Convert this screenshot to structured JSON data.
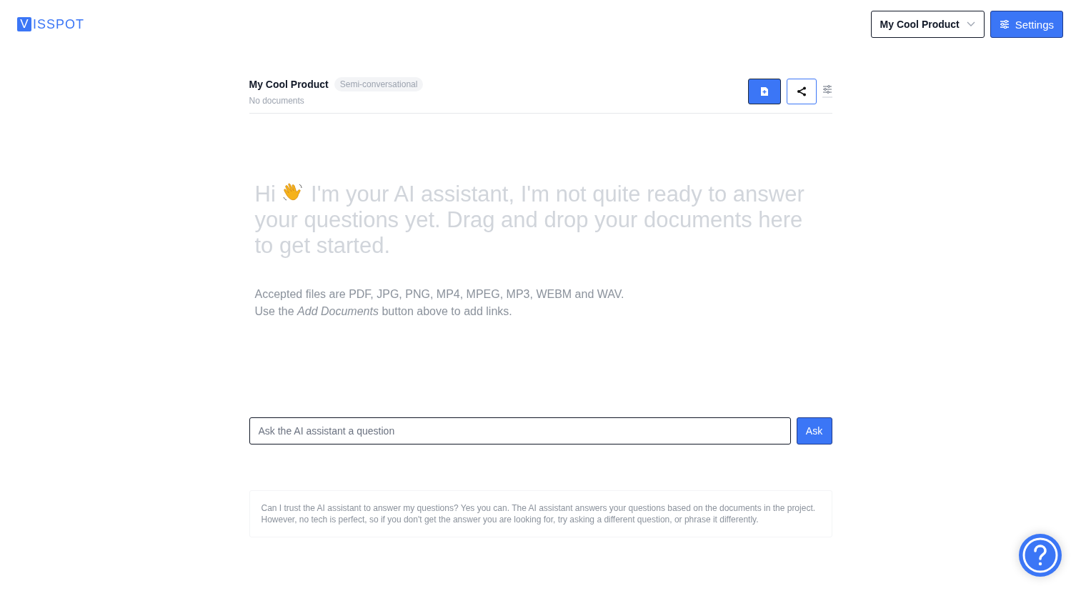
{
  "logo": {
    "mark": "V",
    "text": "ISSPOT"
  },
  "header": {
    "product_select": "My Cool Product",
    "settings_button": "Settings"
  },
  "project": {
    "title": "My Cool Product",
    "mode_badge": "Semi-conversational",
    "subtitle": "No documents"
  },
  "empty_state": {
    "greeting": "Hi",
    "message_first_line": "I'm your AI assistant, I'm not quite ready to answer",
    "message_rest": "your questions yet. Drag and drop your documents here to get started.",
    "notes": [
      "Accepted files are PDF, JPG, PNG, MP4, MPEG, MP3, WEBM and WAV.",
      "Use the *Add Documents* button above to add links."
    ]
  },
  "question": {
    "placeholder": "Ask the AI assistant a question",
    "ask_button": "Ask"
  },
  "disclaimer": [
    "Can I trust the AI assistant to answer my questions? Yes you can. The AI assistant answers your questions based on the documents in the project.",
    "However, no tech is perfect, so if you don't get the answer you are looking for, try asking a different question, or phrase it differently."
  ]
}
